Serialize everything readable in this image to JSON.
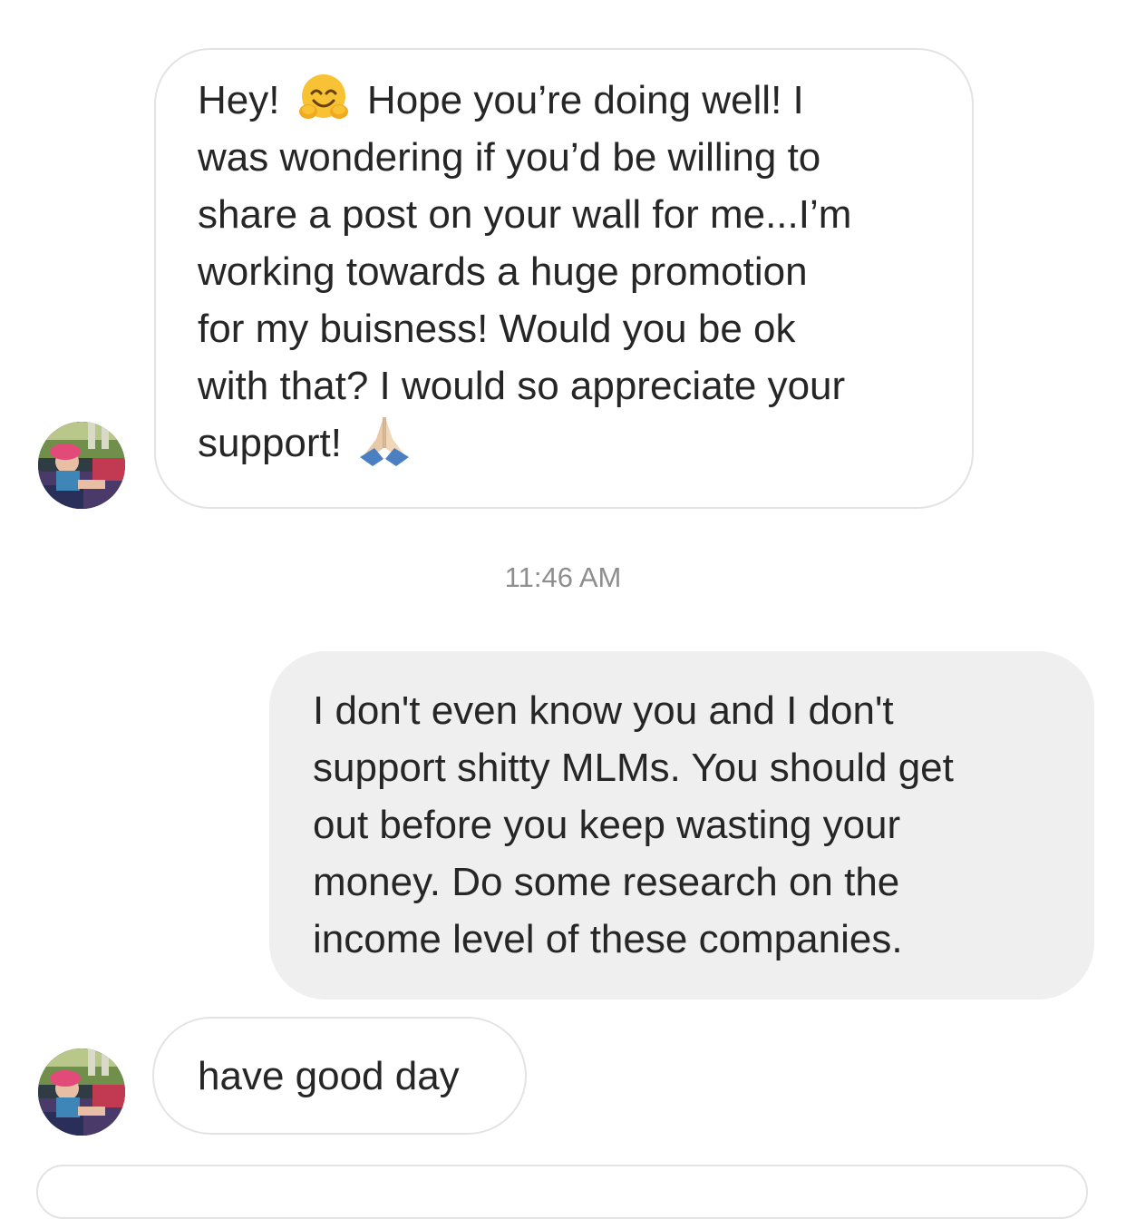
{
  "thread": {
    "messages": [
      {
        "sender": "them",
        "text_before_emoji": "Hey! ",
        "emoji_1": "hugging-face-emoji",
        "text_main": " Hope you’re doing well! I\nwas wondering if you’d be willing to\nshare a post on your wall for me...I’m\nworking towards a huge promotion\nfor my buisness! Would you be ok\nwith that? I would so appreciate your\nsupport! ",
        "emoji_2": "folded-hands-emoji"
      },
      {
        "sender": "me",
        "text": "I don't even know you and I don't\nsupport shitty MLMs. You should get\nout before you keep wasting your\nmoney. Do some research on the\nincome level of these companies."
      },
      {
        "sender": "them",
        "text": "have good day"
      }
    ],
    "timestamp": "11:46 AM"
  },
  "colors": {
    "incoming_bubble_border": "#e3e3e3",
    "outgoing_bubble_bg": "#efefef",
    "text": "#262626",
    "timestamp": "#8e8e8e"
  },
  "icons": {
    "avatar": "profile-photo-avatar",
    "emoji_hug": "hugging-face-emoji",
    "emoji_pray": "folded-hands-emoji"
  }
}
